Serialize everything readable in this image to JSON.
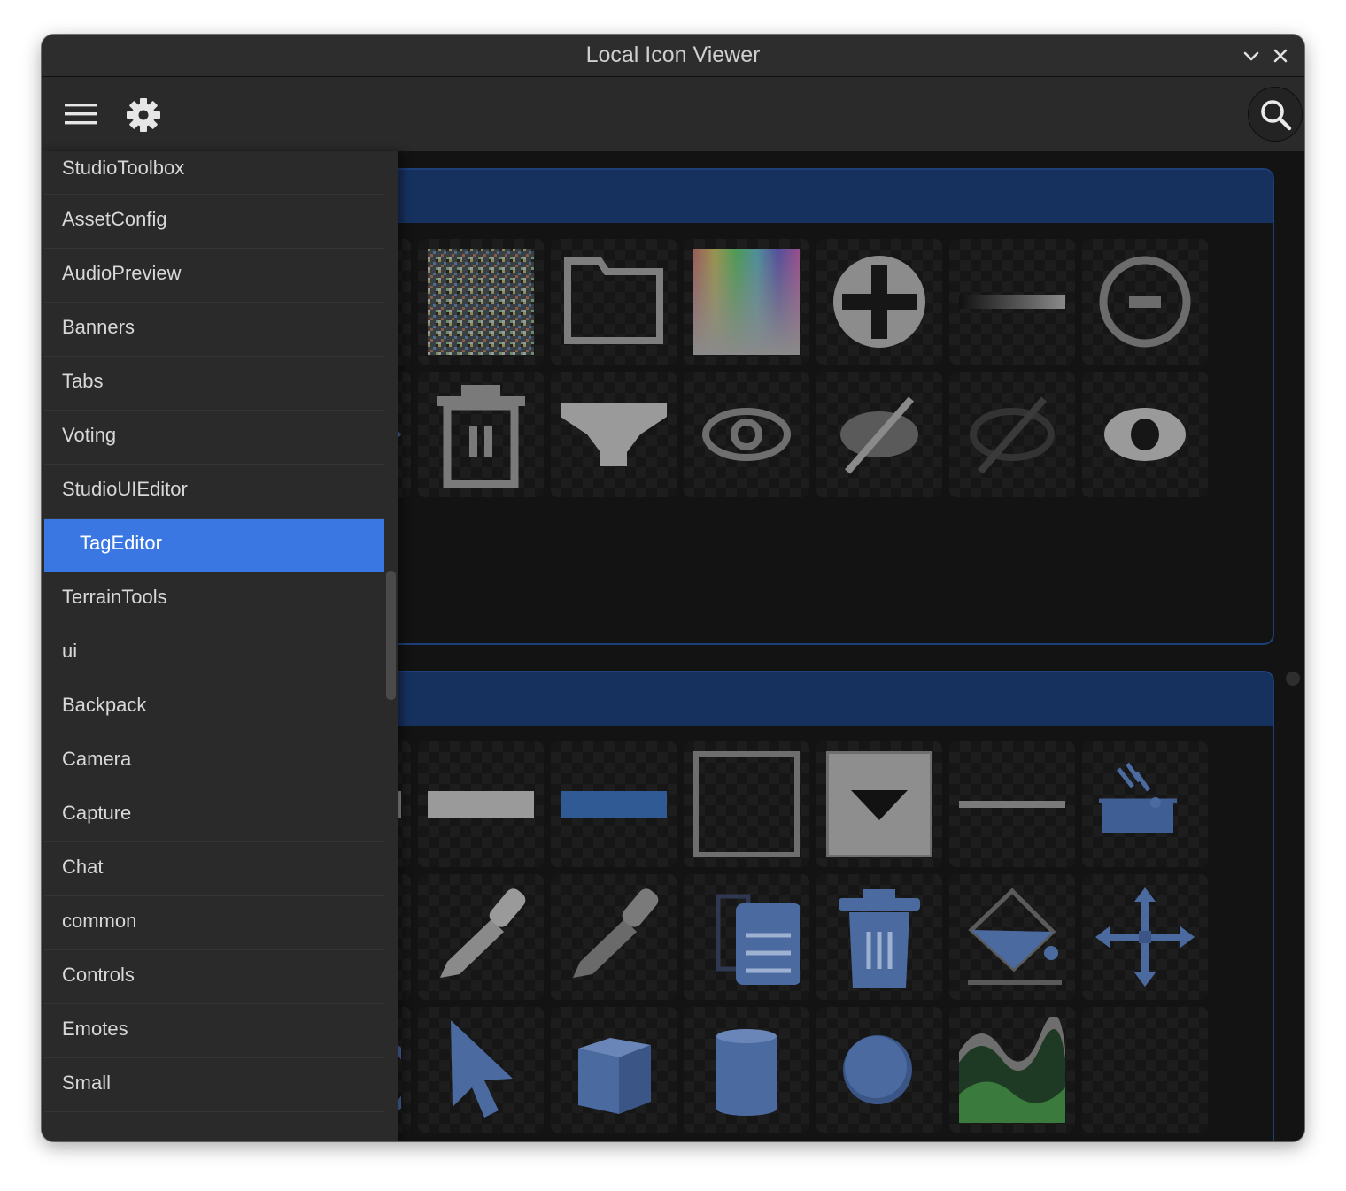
{
  "window": {
    "title": "Local Icon Viewer"
  },
  "toolbar": {
    "menu_icon": "hamburger-icon",
    "settings_icon": "gear-icon",
    "search_icon": "search-icon"
  },
  "sidebar": {
    "selected": "TagEditor",
    "items": [
      {
        "label": "StudioToolbox"
      },
      {
        "label": "AssetConfig"
      },
      {
        "label": "AudioPreview"
      },
      {
        "label": "Banners"
      },
      {
        "label": "Tabs"
      },
      {
        "label": "Voting"
      },
      {
        "label": "StudioUIEditor"
      },
      {
        "label": "TagEditor"
      },
      {
        "label": "TerrainTools"
      },
      {
        "label": "ui"
      },
      {
        "label": "Backpack"
      },
      {
        "label": "Camera"
      },
      {
        "label": "Capture"
      },
      {
        "label": "Chat"
      },
      {
        "label": "common"
      },
      {
        "label": "Controls"
      },
      {
        "label": "Emotes"
      },
      {
        "label": "Small"
      }
    ]
  },
  "colors": {
    "accent": "#3a77e3",
    "card_header": "#17315f",
    "card_border": "#1d3f7a"
  },
  "icon_sections": [
    {
      "icons": [
        "edit-square-icon",
        "noise-texture-icon",
        "folder-icon",
        "color-spectrum-icon",
        "plus-circle-icon",
        "gradient-line-icon",
        "minus-circle-icon",
        "chevron-right-icon",
        "trash-icon",
        "dropdown-triangle-icon",
        "eye-icon",
        "eye-off-icon",
        "eye-off-dim-icon",
        "eye-filled-icon"
      ]
    },
    {
      "icons": [
        "gray-bar-icon",
        "gray-bar-light-icon",
        "blue-bar-icon",
        "empty-frame-icon",
        "dropdown-box-icon",
        "thin-line-icon",
        "paint-tray-icon",
        "eyedropper-icon",
        "eyedropper-icon",
        "eyedropper-icon",
        "clipboard-icon",
        "trash-blue-icon",
        "paint-bucket-icon",
        "move-arrows-icon",
        "rotate-icon",
        "cursor-arrow-icon",
        "cube-icon",
        "cylinder-icon",
        "sphere-icon",
        "terrain-icon",
        "empty-icon"
      ]
    }
  ]
}
